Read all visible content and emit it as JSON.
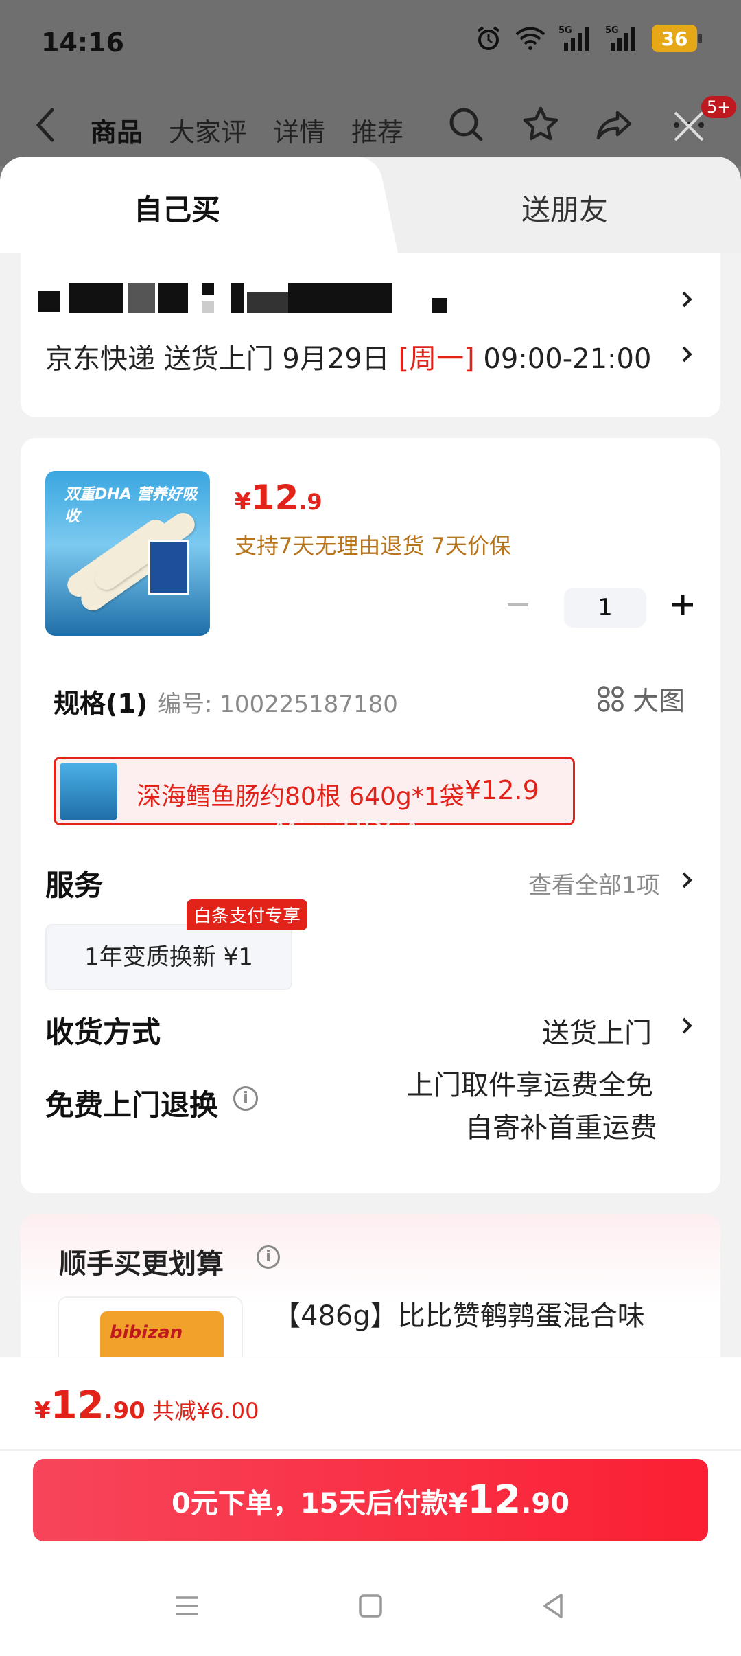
{
  "status_bar": {
    "time": "14:16",
    "battery": "36"
  },
  "nav": {
    "tabs": [
      "商品",
      "大家评",
      "详情",
      "推荐"
    ],
    "badge": "5+"
  },
  "sheet_tabs": {
    "self": "自己买",
    "friend": "送朋友"
  },
  "address": {
    "delivery_prefix": "京东快递 送货上门 9月29日 ",
    "weekday": "[周一]",
    "time_window": " 09:00-21:00"
  },
  "product": {
    "image_caption": "双重DHA 营养好吸收",
    "price_symbol": "¥",
    "price_int": "12",
    "price_dec": ".9",
    "guarantee": "支持7天无理由退货 7天价保",
    "quantity": "1",
    "spec_title": "规格(1)",
    "sku": "编号: 100225187180",
    "big_image": "大图",
    "spec_label": "深海鳕鱼肠约80根 640g*1袋",
    "spec_price": "¥12.9",
    "watermark": "MimiHDSA"
  },
  "service": {
    "title": "服务",
    "view_all": "查看全部1项",
    "item": "1年变质换新 ¥1",
    "tag": "白条支付专享"
  },
  "receive": {
    "title": "收货方式",
    "value": "送货上门"
  },
  "return": {
    "title": "免费上门退换",
    "line1": "上门取件享运费全免",
    "line2": "自寄补首重运费"
  },
  "addon": {
    "title": "顺手买更划算",
    "brand": "bibizan",
    "name": "【486g】比比赞鹌鹑蛋混合味"
  },
  "bottom": {
    "symbol": "¥",
    "total_int": "12",
    "total_dec": ".90",
    "saved": "共减¥6.00",
    "pay_prefix": "0元下单，15天后付款¥",
    "pay_int": "12",
    "pay_dec": ".90"
  },
  "colors": {
    "accent": "#e2231a",
    "pay_button": "#fb1f33"
  },
  "icons": [
    "back-icon",
    "search-icon",
    "star-icon",
    "share-icon",
    "more-icon",
    "close-icon",
    "grid-icon",
    "info-icon",
    "chevron-right-icon",
    "minus-icon",
    "plus-icon",
    "menu-icon",
    "home-icon",
    "back-triangle-icon"
  ]
}
